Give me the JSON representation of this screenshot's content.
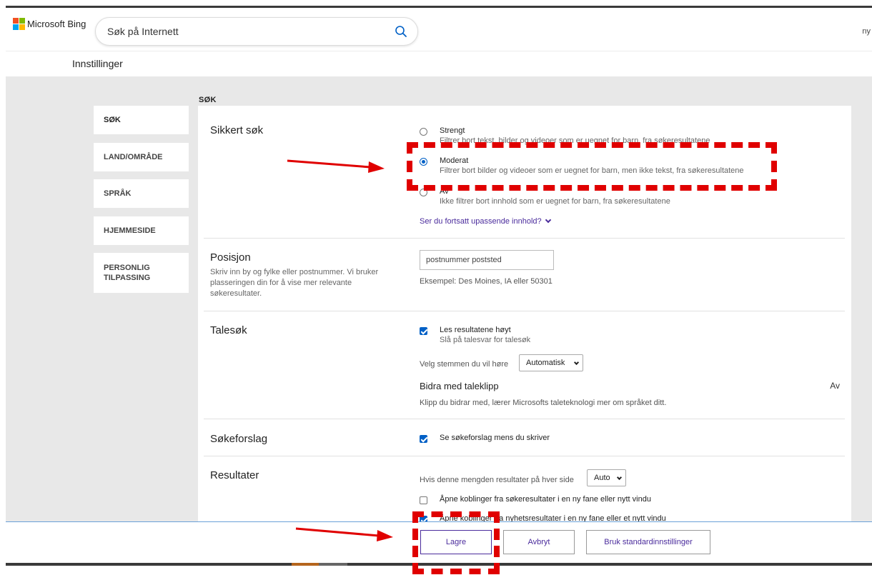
{
  "header": {
    "brand": "Microsoft Bing",
    "search_placeholder": "Søk på Internett",
    "right_text": "ny"
  },
  "page_title": "Innstillinger",
  "section_label": "SØK",
  "sidebar": {
    "items": [
      {
        "label": "SØK"
      },
      {
        "label": "LAND/OMRÅDE"
      },
      {
        "label": "SPRÅK"
      },
      {
        "label": "HJEMMESIDE"
      },
      {
        "label": "PERSONLIG TILPASSING"
      }
    ]
  },
  "safe_search": {
    "title": "Sikkert søk",
    "options": [
      {
        "label": "Strengt",
        "desc": "Filtrer bort tekst, bilder og videoer som er uegnet for barn, fra søkeresultatene",
        "selected": false
      },
      {
        "label": "Moderat",
        "desc": "Filtrer bort bilder og videoer som er uegnet for barn, men ikke tekst, fra søkeresultatene",
        "selected": true
      },
      {
        "label": "Av",
        "desc": "Ikke filtrer bort innhold som er uegnet for barn, fra søkeresultatene",
        "selected": false
      }
    ],
    "link": "Ser du fortsatt upassende innhold?"
  },
  "position": {
    "title": "Posisjon",
    "desc": "Skriv inn by og fylke eller postnummer. Vi bruker plasseringen din for å vise mer relevante søkeresultater.",
    "placeholder": "postnummer poststed",
    "example": "Eksempel: Des Moines, IA eller 50301"
  },
  "voice": {
    "title": "Talesøk",
    "read_label": "Les resultatene høyt",
    "read_sub": "Slå på talesvar for talesøk",
    "voice_label": "Velg stemmen du vil høre",
    "voice_value": "Automatisk",
    "contrib_title": "Bidra med taleklipp",
    "contrib_state": "Av",
    "contrib_desc": "Klipp du bidrar med, lærer Microsofts taleteknologi mer om språket ditt."
  },
  "suggestions": {
    "title": "Søkeforslag",
    "label": "Se søkeforslag mens du skriver"
  },
  "results": {
    "title": "Resultater",
    "count_label": "Hvis denne mengden resultater på hver side",
    "count_value": "Auto",
    "open_search_label": "Åpne koblinger fra søkeresultater i en ny fane eller nytt vindu",
    "open_news_label": "Åpne koblinger fra nyhetsresultater i en ny fane eller et nytt vindu"
  },
  "footer": {
    "save": "Lagre",
    "cancel": "Avbryt",
    "defaults": "Bruk standardinnstillinger"
  },
  "colors": {
    "annotation": "#e00000",
    "accent": "#0060c6",
    "link": "#4a2b9c"
  }
}
